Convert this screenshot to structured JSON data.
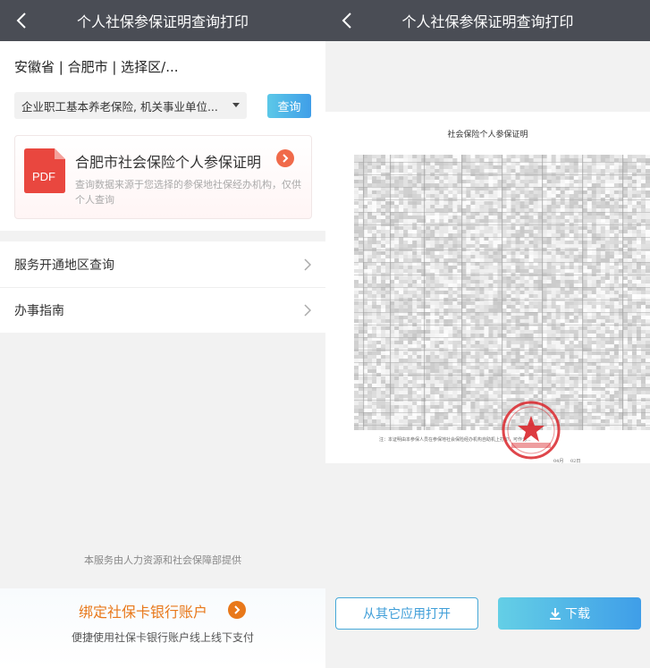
{
  "left": {
    "title": "个人社保参保证明查询打印",
    "region": "安徽省 | 合肥市 | 选择区/...",
    "insurance_select": "企业职工基本养老保险, 机关事业单位...",
    "query_button": "查询",
    "pdf_card": {
      "icon_label": "PDF",
      "title": "合肥市社会保险个人参保证明",
      "desc": "查询数据来源于您选择的参保地社保经办机构，仅供个人查询"
    },
    "menu": [
      {
        "label": "服务开通地区查询"
      },
      {
        "label": "办事指南"
      }
    ],
    "provider_note": "本服务由人力资源和社会保障部提供",
    "bind_card": {
      "title": "绑定社保卡银行账户",
      "subtitle": "便捷使用社保卡银行账户线上线下支付"
    }
  },
  "right": {
    "title": "个人社保参保证明查询打印",
    "document": {
      "title": "社会保险个人参保证明",
      "note": "注：本证明由本参保人员在参保地社会保险经办机构自助机上打印，可作为...",
      "date_month_label": "04月",
      "date_day_label": "02日"
    },
    "open_button": "从其它应用打开",
    "download_button": "下载"
  },
  "colors": {
    "topbar": "#4a4d55",
    "accent_blue": "#3f9ee8",
    "accent_orange": "#e8781a",
    "pdf_red": "#e9473f"
  }
}
